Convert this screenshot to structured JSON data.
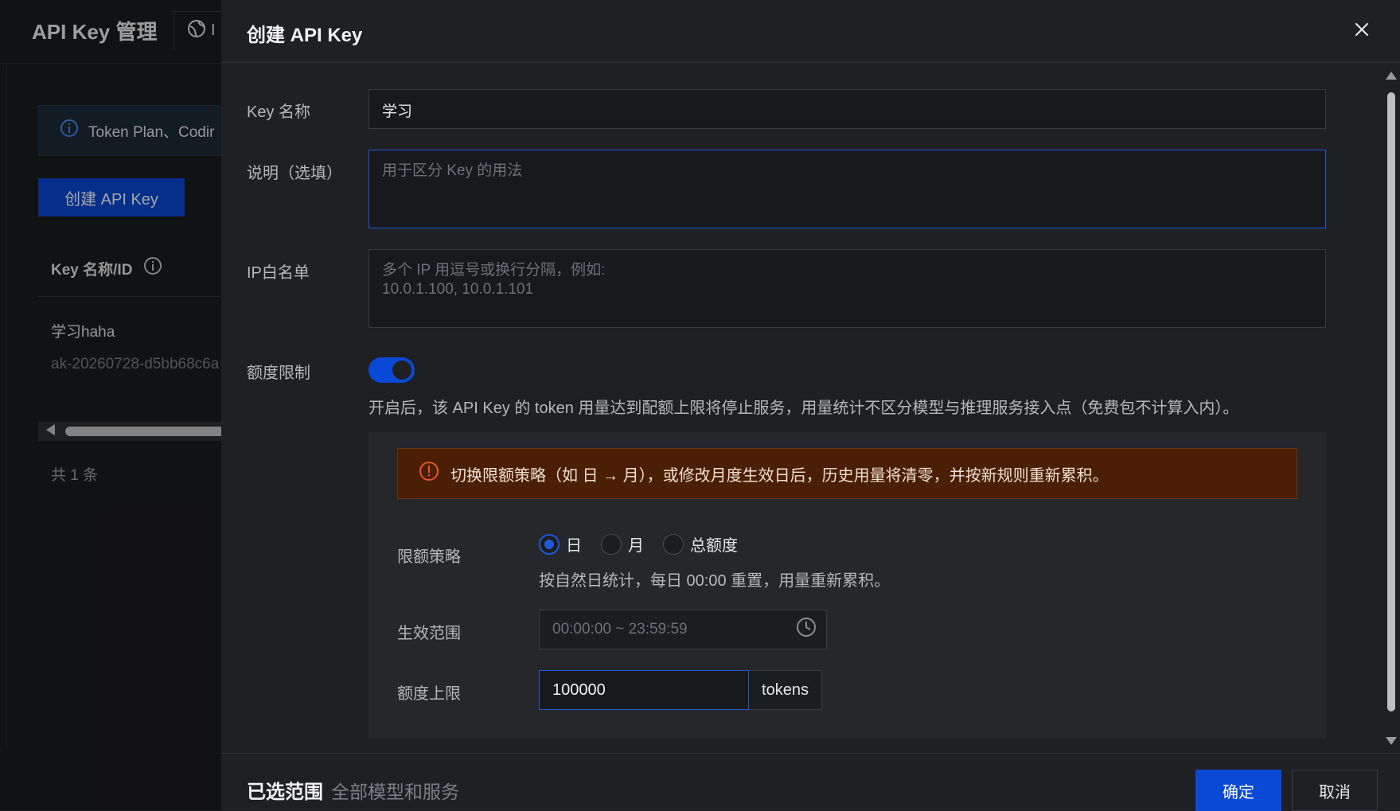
{
  "background": {
    "page_title": "API Key 管理",
    "tab_label": "I",
    "notice_text": "Token Plan、Codir",
    "create_button": "创建 API Key",
    "column_header": "Key 名称/ID",
    "key_name": "学习haha",
    "key_id": "ak-20260728-d5bb68c6a",
    "total_count": "共 1 条"
  },
  "drawer": {
    "title": "创建 API Key",
    "fields": {
      "name": {
        "label": "Key 名称",
        "value": "学习"
      },
      "description": {
        "label": "说明（选填）",
        "placeholder": "用于区分 Key 的用法"
      },
      "ip_whitelist": {
        "label": "IP白名单",
        "placeholder": "多个 IP 用逗号或换行分隔，例如:\n10.0.1.100, 10.0.1.101"
      }
    },
    "quota": {
      "label": "额度限制",
      "enabled": true,
      "hint": "开启后，该 API Key 的 token 用量达到配额上限将停止服务，用量统计不区分模型与推理服务接入点（免费包不计算入内）。",
      "warning": "切换限额策略（如 日 → 月），或修改月度生效日后，历史用量将清零，并按新规则重新累积。",
      "strategy_label": "限额策略",
      "strategy_options": [
        "日",
        "月",
        "总额度"
      ],
      "strategy_selected": "日",
      "strategy_hint": "按自然日统计，每日 00:00 重置，用量重新累积。",
      "range_label": "生效范围",
      "range_placeholder": "00:00:00 ~ 23:59:59",
      "limit_label": "额度上限",
      "limit_value": "100000",
      "limit_unit": "tokens"
    },
    "footer": {
      "scope_label": "已选范围",
      "scope_value": "全部模型和服务",
      "ok_button": "确定",
      "cancel_button": "取消"
    }
  },
  "colors": {
    "accent": "#0a49d6",
    "warning_bg": "#4a1f05",
    "warning_icon": "#e8562a",
    "info_icon": "#4a8df0"
  }
}
